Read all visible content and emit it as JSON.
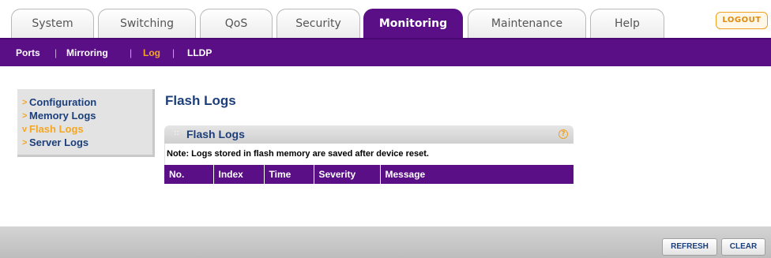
{
  "tabs": [
    {
      "label": "System"
    },
    {
      "label": "Switching"
    },
    {
      "label": "QoS"
    },
    {
      "label": "Security"
    },
    {
      "label": "Monitoring"
    },
    {
      "label": "Maintenance"
    },
    {
      "label": "Help"
    }
  ],
  "logout_label": "LOGOUT",
  "subnav": [
    {
      "label": "Ports"
    },
    {
      "label": "Mirroring"
    },
    {
      "label": "Log"
    },
    {
      "label": "LLDP"
    }
  ],
  "leftnav": [
    {
      "marker": ">",
      "label": "Configuration"
    },
    {
      "marker": ">",
      "label": "Memory Logs"
    },
    {
      "marker": "v",
      "label": "Flash Logs"
    },
    {
      "marker": ">",
      "label": "Server Logs"
    }
  ],
  "page_title": "Flash Logs",
  "panel": {
    "title": "Flash Logs",
    "help": "?",
    "note": "Note: Logs stored in flash memory are saved after device reset.",
    "columns": [
      "No.",
      "Index",
      "Time",
      "Severity",
      "Message"
    ]
  },
  "footer": {
    "refresh_label": "REFRESH",
    "clear_label": "CLEAR"
  },
  "colors": {
    "accent_purple": "#5a0f86",
    "highlight_orange": "#f5a623",
    "link_blue": "#1c3f7a"
  }
}
